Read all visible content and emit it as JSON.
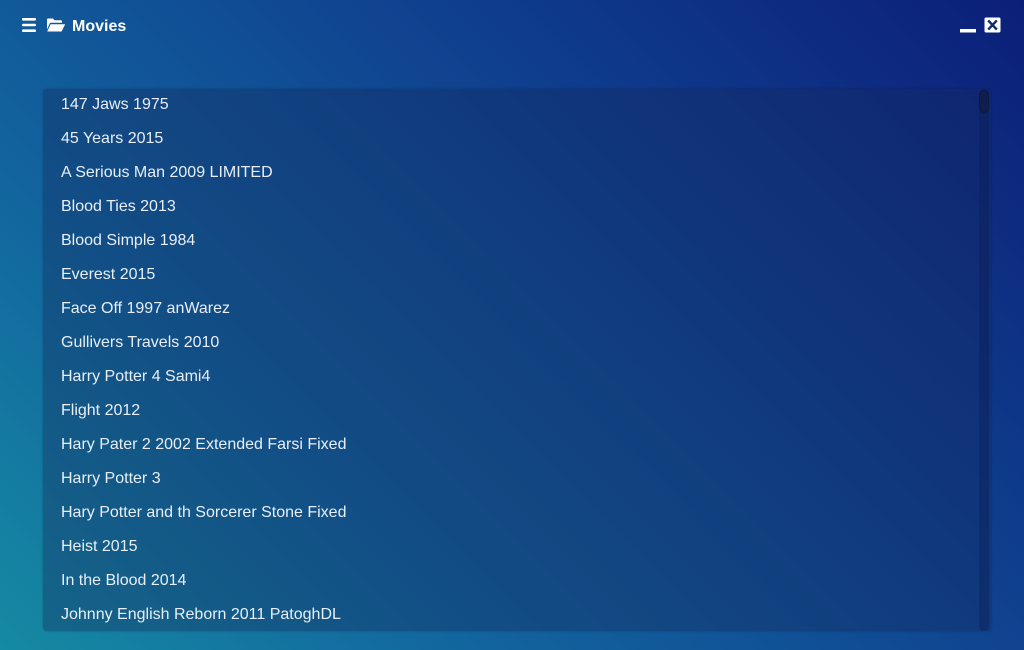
{
  "window": {
    "title": "Movies",
    "menu_icon": "hamburger-menu-icon",
    "folder_icon": "open-folder-icon",
    "minimize_icon": "minimize-icon",
    "close_icon": "close-icon"
  },
  "colors": {
    "background_top_right": "#0c1f78",
    "background_bottom_left": "#158aa3",
    "text": "#e8eef6"
  },
  "movies": [
    "147 Jaws 1975",
    "45 Years 2015",
    "A Serious Man 2009 LIMITED",
    "Blood Ties 2013",
    "Blood Simple 1984",
    "Everest 2015",
    "Face Off 1997 anWarez",
    "Gullivers Travels 2010",
    "Harry Potter 4 Sami4",
    "Flight 2012",
    "Hary Pater 2 2002 Extended Farsi Fixed",
    "Harry Potter 3",
    "Hary Potter and th Sorcerer Stone Fixed",
    "Heist 2015",
    "In the Blood 2014",
    "Johnny English Reborn 2011 PatoghDL"
  ]
}
